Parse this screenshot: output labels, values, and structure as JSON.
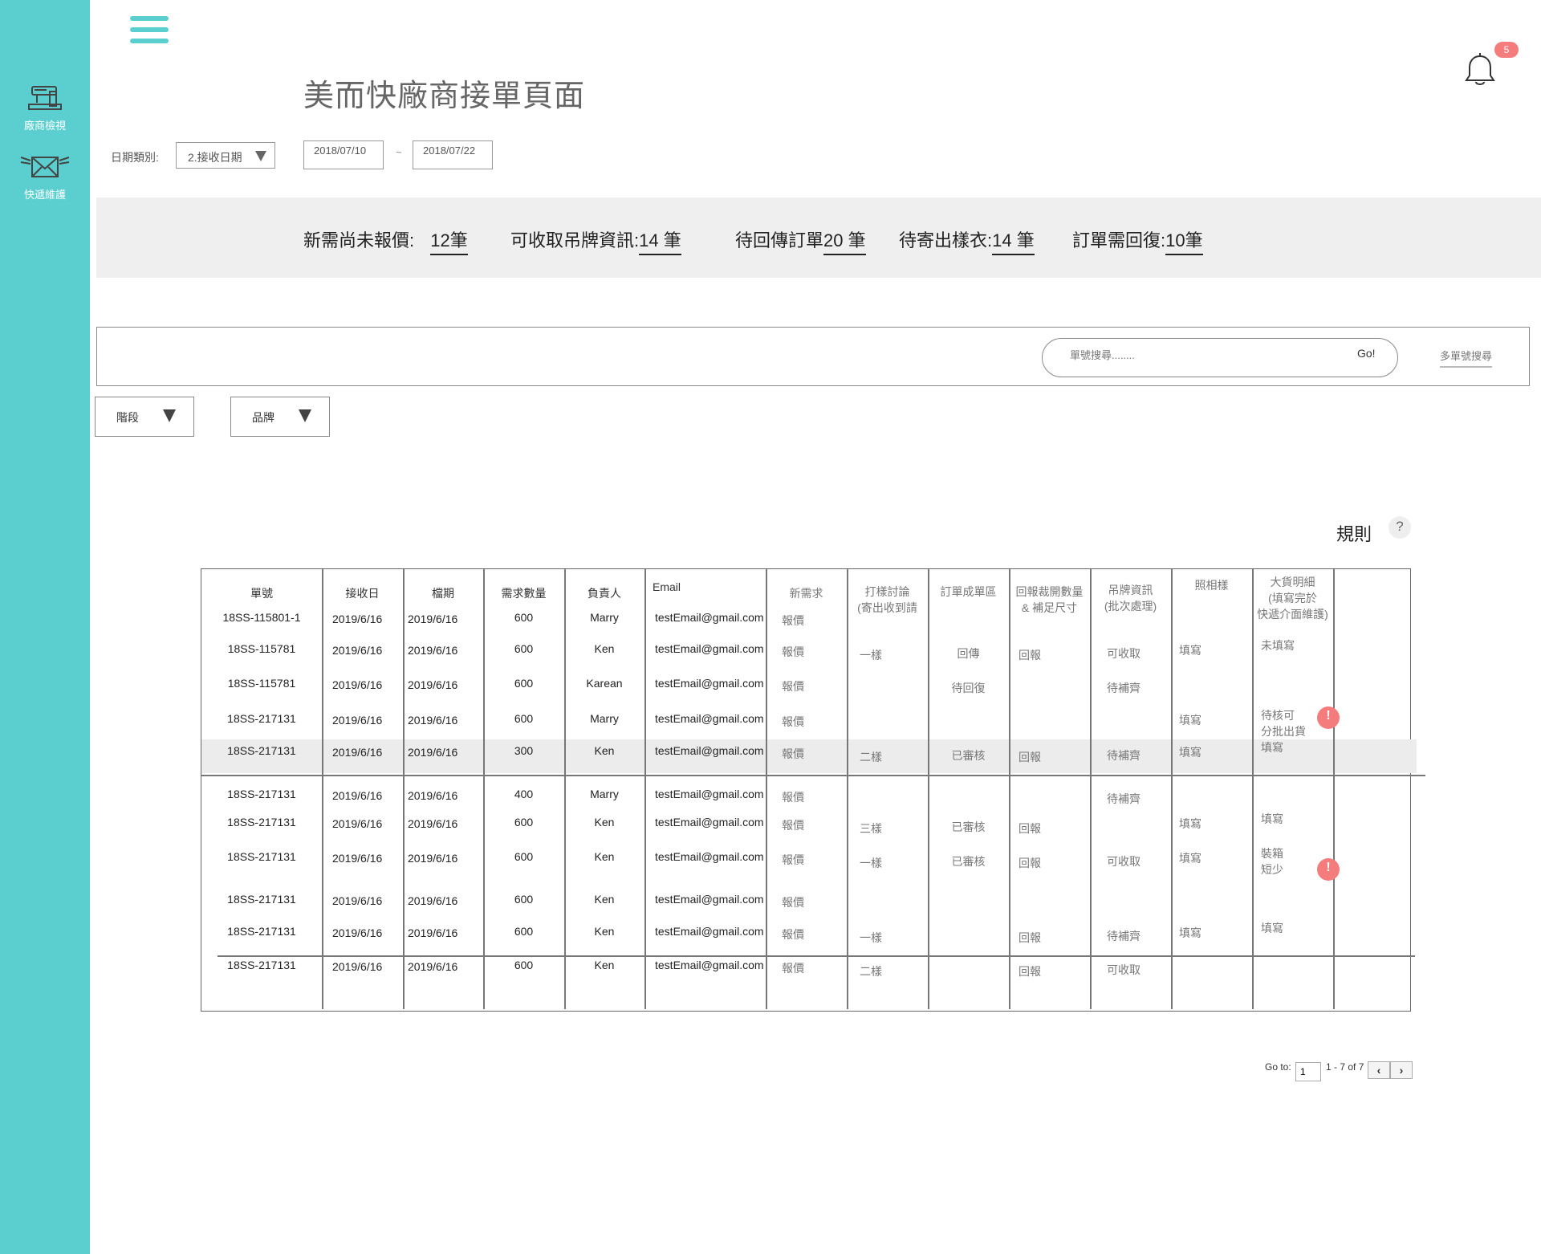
{
  "title": "美而快廠商接單頁面",
  "notification_count": "5",
  "sidebar": {
    "items": [
      {
        "label": "廠商檢視",
        "icon": "sewing-machine-icon"
      },
      {
        "label": "快遞維護",
        "icon": "envelope-wings-icon"
      }
    ]
  },
  "date_filter": {
    "label": "日期類別:",
    "type_value": "2.接收日期",
    "start": "2018/07/10",
    "separator": "~",
    "end": "2018/07/22"
  },
  "summary": [
    {
      "label": "新需尚未報價:",
      "value": "12筆"
    },
    {
      "label": "可收取吊牌資訊:",
      "value": "14 筆"
    },
    {
      "label": "待回傳訂單",
      "value": "20 筆"
    },
    {
      "label": "待寄出樣衣:",
      "value": "14 筆"
    },
    {
      "label": "訂單需回復:",
      "value": "10筆"
    }
  ],
  "search": {
    "placeholder": "單號搜尋........",
    "go_label": "Go!",
    "multi_label": "多單號搜尋"
  },
  "filters": {
    "stage_label": "階段",
    "brand_label": "品牌"
  },
  "rules_label": "規則",
  "rules_help": "?",
  "table": {
    "headers": [
      "單號",
      "接收日",
      "檔期",
      "需求數量",
      "負責人",
      "Email",
      "新需求",
      "打樣討論\n(寄出收到請",
      "訂單成單區",
      "回報裁開數量\n& 補足尺寸",
      "吊牌資訊\n(批次處理)",
      "照相樣",
      "大貨明細\n(填寫完於\n快遞介面維護)"
    ],
    "rows": [
      {
        "id": "18SS-115801-1",
        "recv": "2019/6/16",
        "sched": "2019/6/16",
        "qty": "600",
        "owner": "Marry",
        "email": "testEmail@gmail.com",
        "new": "報價",
        "sample": "",
        "order": "",
        "report": "",
        "tag": "",
        "photo": "",
        "bulk": ""
      },
      {
        "id": "18SS-115781",
        "recv": "2019/6/16",
        "sched": "2019/6/16",
        "qty": "600",
        "owner": "Ken",
        "email": "testEmail@gmail.com",
        "new": "報價",
        "sample": "一樣",
        "order": "回傳",
        "report": "回報",
        "tag": "可收取",
        "photo": "填寫",
        "bulk": "未填寫"
      },
      {
        "id": "18SS-115781",
        "recv": "2019/6/16",
        "sched": "2019/6/16",
        "qty": "600",
        "owner": "Karean",
        "email": "testEmail@gmail.com",
        "new": "報價",
        "sample": "",
        "order": "待回復",
        "report": "",
        "tag": "待補齊",
        "photo": "",
        "bulk": ""
      },
      {
        "id": "18SS-217131",
        "recv": "2019/6/16",
        "sched": "2019/6/16",
        "qty": "600",
        "owner": "Marry",
        "email": "testEmail@gmail.com",
        "new": "報價",
        "sample": "",
        "order": "",
        "report": "",
        "tag": "",
        "photo": "填寫",
        "bulk": "待核可\n分批出貨"
      },
      {
        "id": "18SS-217131",
        "recv": "2019/6/16",
        "sched": "2019/6/16",
        "qty": "300",
        "owner": "Ken",
        "email": "testEmail@gmail.com",
        "new": "報價",
        "sample": "二樣",
        "order": "已審核",
        "report": "回報",
        "tag": "待補齊",
        "photo": "填寫",
        "bulk": "填寫"
      },
      {
        "id": "18SS-217131",
        "recv": "2019/6/16",
        "sched": "2019/6/16",
        "qty": "400",
        "owner": "Marry",
        "email": "testEmail@gmail.com",
        "new": "報價",
        "sample": "",
        "order": "",
        "report": "",
        "tag": "待補齊",
        "photo": "",
        "bulk": ""
      },
      {
        "id": "18SS-217131",
        "recv": "2019/6/16",
        "sched": "2019/6/16",
        "qty": "600",
        "owner": "Ken",
        "email": "testEmail@gmail.com",
        "new": "報價",
        "sample": "三樣",
        "order": "已審核",
        "report": "回報",
        "tag": "",
        "photo": "填寫",
        "bulk": "填寫"
      },
      {
        "id": "18SS-217131",
        "recv": "2019/6/16",
        "sched": "2019/6/16",
        "qty": "600",
        "owner": "Ken",
        "email": "testEmail@gmail.com",
        "new": "報價",
        "sample": "一樣",
        "order": "已審核",
        "report": "回報",
        "tag": "可收取",
        "photo": "填寫",
        "bulk": "裝箱\n短少"
      },
      {
        "id": "18SS-217131",
        "recv": "2019/6/16",
        "sched": "2019/6/16",
        "qty": "600",
        "owner": "Ken",
        "email": "testEmail@gmail.com",
        "new": "報價",
        "sample": "",
        "order": "",
        "report": "",
        "tag": "",
        "photo": "",
        "bulk": ""
      },
      {
        "id": "18SS-217131",
        "recv": "2019/6/16",
        "sched": "2019/6/16",
        "qty": "600",
        "owner": "Ken",
        "email": "testEmail@gmail.com",
        "new": "報價",
        "sample": "一樣",
        "order": "",
        "report": "回報",
        "tag": "待補齊",
        "photo": "填寫",
        "bulk": "填寫"
      },
      {
        "id": "18SS-217131",
        "recv": "2019/6/16",
        "sched": "2019/6/16",
        "qty": "600",
        "owner": "Ken",
        "email": "testEmail@gmail.com",
        "new": "報價",
        "sample": "二樣",
        "order": "",
        "report": "回報",
        "tag": "可收取",
        "photo": "",
        "bulk": ""
      }
    ],
    "alert_symbol": "!"
  },
  "pagination": {
    "goto_label": "Go to:",
    "page_value": "1",
    "range": "1 - 7 of 7",
    "prev": "‹",
    "next": "›"
  },
  "colors": {
    "accent": "#5bcfcf",
    "alert": "#f47c7c",
    "summary_bg": "#efefef"
  }
}
